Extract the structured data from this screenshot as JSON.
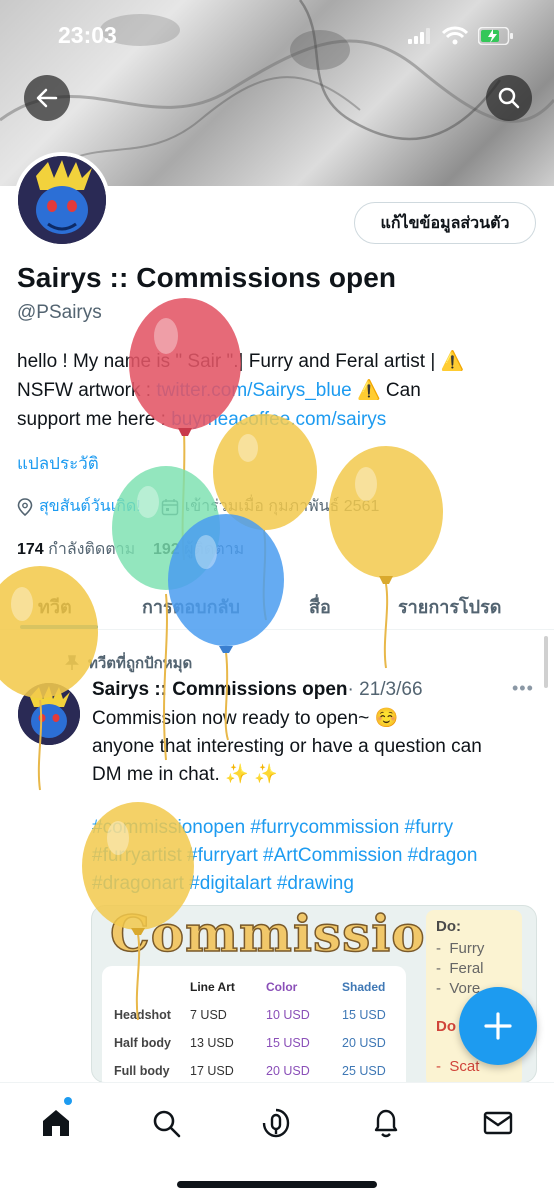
{
  "status_bar": {
    "time": "23:03"
  },
  "profile": {
    "edit_label": "แก้ไขข้อมูลส่วนตัว",
    "name": "Sairys :: Commissions open",
    "handle": "@PSairys",
    "bio_line1": "hello ! My name is \" Sair \".| Furry and Feral artist | ⚠️",
    "bio_line2_prefix": "NSFW artwork : ",
    "bio_link1": "twitter.com/Sairys_blue",
    "bio_line2_suffix": " ⚠️ Can",
    "bio_line3_prefix": "support me here : ",
    "bio_link2": "buymeacoffee.com/sairys",
    "translate": "แปลประวัติ",
    "location": "สุขสันต์วันเกิด!",
    "joined": "เข้าร่วมเมื่อ กุมภาพันธ์ 2561",
    "following_count": "174",
    "following_label": "กำลังติดตาม",
    "followers_count": "192",
    "followers_label": "ผู้ติดตาม"
  },
  "tabs": [
    {
      "label": "ทวีต"
    },
    {
      "label": "การตอบกลับ"
    },
    {
      "label": "สื่อ"
    },
    {
      "label": "รายการโปรด"
    }
  ],
  "tweet": {
    "pinned_label": "ทวีตที่ถูกปักหมุด",
    "author": "Sairys :: Commissions open",
    "date": "· 21/3/66",
    "text_line1": "Commission now ready to open~  ☺️",
    "text_line2": "anyone that interesting or have a question can",
    "text_line3": "DM  me in chat. ✨ ✨",
    "hashtags": "#commissionopen #furrycommission #furry #furryartist #furryart #ArtCommission #dragon #dragonart #digitalart #drawing"
  },
  "commission_card": {
    "title": "Commission",
    "columns": [
      "Line Art",
      "Color",
      "Shaded"
    ],
    "rows": [
      {
        "label": "Headshot",
        "prices": [
          "7 USD",
          "10 USD",
          "15 USD"
        ]
      },
      {
        "label": "Half body",
        "prices": [
          "13 USD",
          "15 USD",
          "20 USD"
        ]
      },
      {
        "label": "Full body",
        "prices": [
          "17 USD",
          "20 USD",
          "25 USD"
        ]
      }
    ],
    "do_header": "Do:",
    "do_items": [
      "Furry",
      "Feral",
      "Vore"
    ],
    "dont_header": "Do",
    "dont_items": [
      "Scat"
    ]
  },
  "colors": {
    "accent": "#1d9bf0",
    "balloon_red": "#e25565",
    "balloon_yellow": "#f2c94c",
    "balloon_green": "#7be0b0",
    "balloon_blue": "#4a9cf0"
  },
  "icons": {
    "back": "back-arrow-icon",
    "search": "search-icon",
    "location": "location-pin-icon",
    "calendar": "calendar-icon",
    "pin": "pin-icon",
    "more": "more-icon",
    "compose": "plus-icon",
    "nav": [
      "home-icon",
      "search-icon",
      "spaces-icon",
      "notifications-icon",
      "messages-icon"
    ]
  }
}
